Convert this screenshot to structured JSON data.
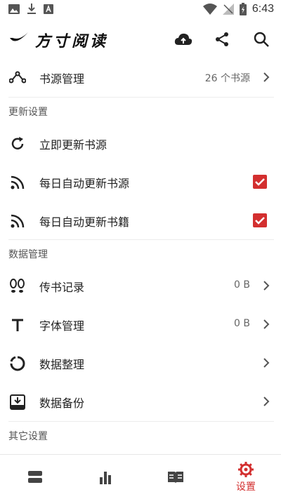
{
  "status_bar": {
    "time": "6:43",
    "icons": [
      "image-icon",
      "download-icon",
      "text-icon",
      "wifi-icon",
      "no-signal-icon",
      "battery-icon"
    ]
  },
  "app_bar": {
    "title": "方寸阅读",
    "actions": [
      "cloud-upload-icon",
      "share-icon",
      "search-icon"
    ]
  },
  "book_source": {
    "label": "书源管理",
    "value": "26 个书源"
  },
  "sections": {
    "update": "更新设置",
    "data": "数据管理",
    "other": "其它设置"
  },
  "update_items": [
    {
      "label": "立即更新书源"
    },
    {
      "label": "每日自动更新书源",
      "checked": true
    },
    {
      "label": "每日自动更新书籍",
      "checked": true
    }
  ],
  "data_items": [
    {
      "label": "传书记录",
      "value": "0 B"
    },
    {
      "label": "字体管理",
      "value": "0 B"
    },
    {
      "label": "数据整理"
    },
    {
      "label": "数据备份"
    }
  ],
  "bottom_nav": {
    "tabs": [
      {
        "icon": "bookshelf-icon"
      },
      {
        "icon": "ranking-icon"
      },
      {
        "icon": "book-open-icon"
      },
      {
        "icon": "gear-icon",
        "label": "设置",
        "active": true
      }
    ],
    "accent": "#d32f2f"
  }
}
